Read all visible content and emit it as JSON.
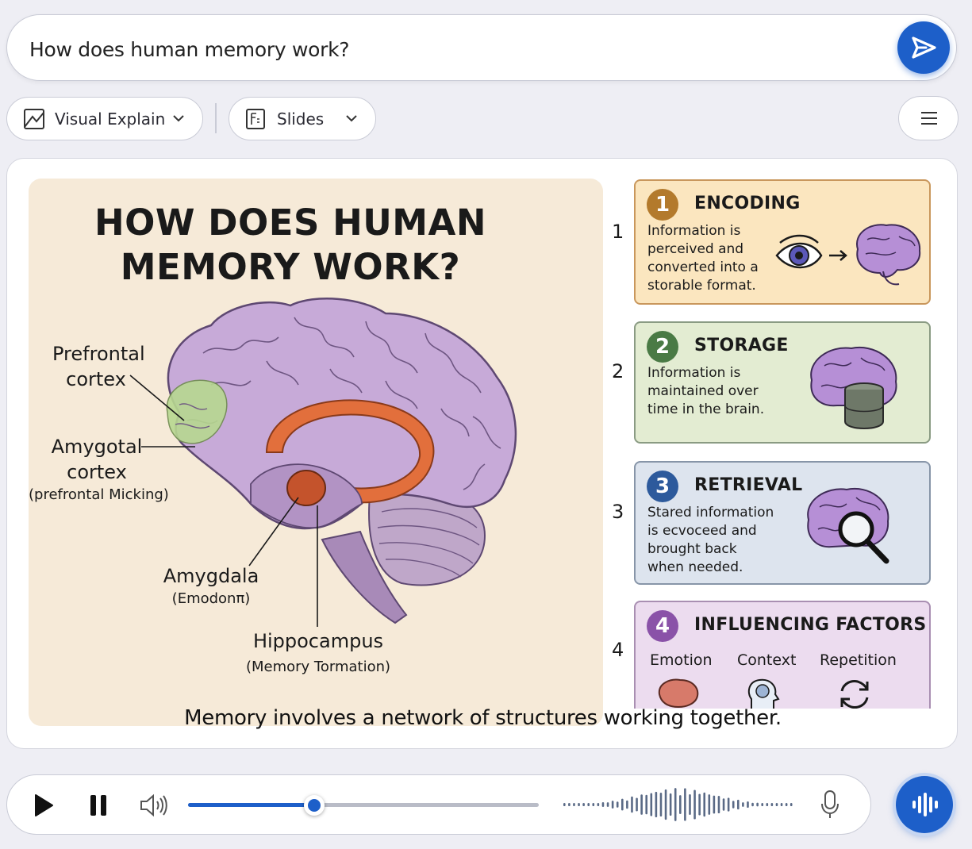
{
  "query": {
    "text": "How does human memory work?"
  },
  "toolbar": {
    "visual_explain_label": "Visual Explain",
    "slides_label": "Slides"
  },
  "illustration": {
    "title_line1": "HOW DOES HUMAN",
    "title_line2": "MEMORY WORK?",
    "labels": {
      "prefrontal_line1": "Prefrontal",
      "prefrontal_line2": "cortex",
      "amygotal_line1": "Amygotal",
      "amygotal_line2": "cortex",
      "amygotal_sub": "(prefrontal Micking)",
      "amygdala": "Amygdala",
      "amygdala_sub": "(Emodonπ)",
      "hippocampus": "Hippocampus",
      "hippocampus_sub": "(Memory Tormation)"
    },
    "caption": "Memory involves a network of structures working together."
  },
  "steps": [
    {
      "index": "1",
      "badge": "1",
      "title": "ENCODING",
      "text": "Information is\nperceived and\nconverted into a\nstorable format.",
      "bg": "#fbe6bf",
      "border": "#c9975c",
      "badge_color": "#b37a2c"
    },
    {
      "index": "2",
      "badge": "2",
      "title": "STORAGE",
      "text": "Information is\nmaintained over\ntime in the brain.",
      "bg": "#e3ecd2",
      "border": "#8a9b83",
      "badge_color": "#4a7a45"
    },
    {
      "index": "3",
      "badge": "3",
      "title": "RETRIEVAL",
      "text": "Stared information\nis ecvoceed and\nbrought back\nwhen needed.",
      "bg": "#dde4ee",
      "border": "#8795a8",
      "badge_color": "#2d5a9c"
    },
    {
      "index": "4",
      "badge": "4",
      "title": "INFLUENCING FACTORS",
      "bg": "#ecdcef",
      "border": "#a98fb2",
      "badge_color": "#8a52a8",
      "factors": [
        "Emotion",
        "Context",
        "Repetition"
      ]
    }
  ],
  "player": {
    "progress_fraction": 0.36
  },
  "colors": {
    "accent": "#1d5fc9"
  },
  "icons": {
    "send": "send-icon",
    "visual_explain": "document-chart-icon",
    "slides": "slides-icon",
    "menu": "menu-icon",
    "play": "play-icon",
    "pause": "pause-icon",
    "volume": "volume-icon",
    "mic": "microphone-icon",
    "voice": "voice-wave-icon"
  }
}
